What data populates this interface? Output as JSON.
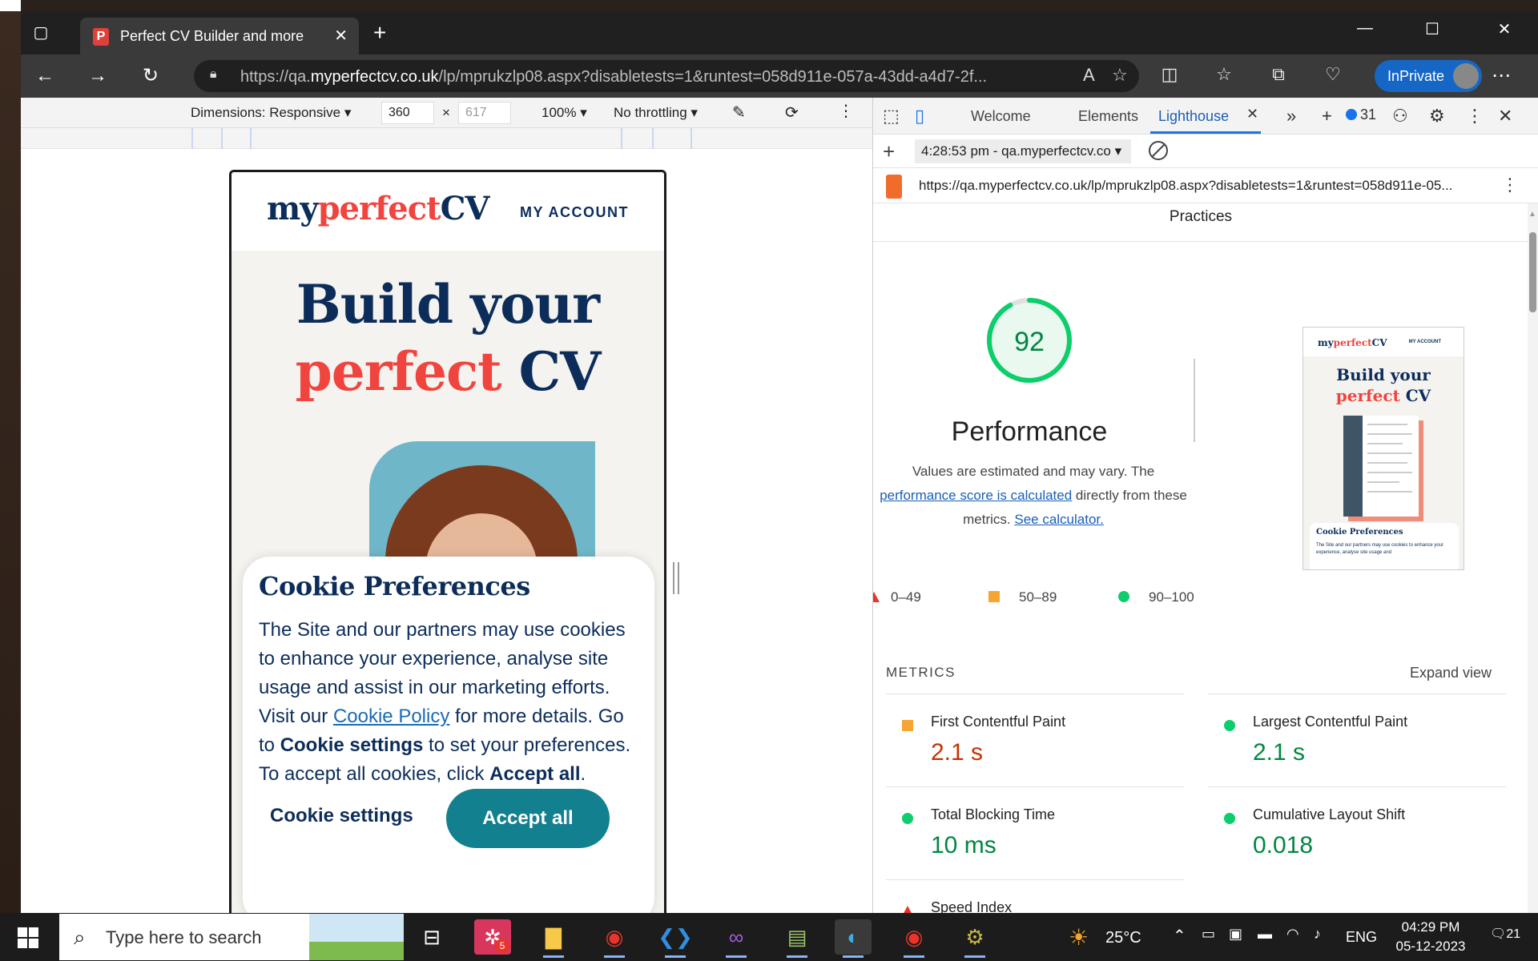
{
  "browser": {
    "tab_title": "Perfect CV Builder and more",
    "url_prefix": "https://qa.",
    "url_domain": "myperfectcv.co.uk",
    "url_rest": "/lp/mprukzlp08.aspx?disabletests=1&runtest=058d911e-057a-43dd-a4d7-2f...",
    "inprivate_label": "InPrivate"
  },
  "device_toolbar": {
    "dimensions_label": "Dimensions: Responsive",
    "width": "360",
    "height": "617",
    "zoom": "100%",
    "throttling": "No throttling"
  },
  "site": {
    "logo_part1": "my",
    "logo_part2": "perfect",
    "logo_part3": "CV",
    "account_link": "MY ACCOUNT",
    "hero_line1": "Build your",
    "hero_line2_red": "perfect",
    "hero_line2_rest": " CV",
    "cookie": {
      "title": "Cookie Preferences",
      "text_1": "The Site and our partners may use cookies to enhance your experience, analyse site usage and assist in our marketing efforts. Visit our ",
      "policy_link": "Cookie Policy",
      "text_2": " for more details. Go to ",
      "settings_bold": "Cookie settings",
      "text_3": " to set your preferences. To accept all cookies, click ",
      "accept_bold": "Accept all",
      "text_4": ".",
      "settings_button": "Cookie settings",
      "accept_button": "Accept all"
    }
  },
  "devtools": {
    "tabs": [
      "Welcome",
      "Elements",
      "Lighthouse"
    ],
    "issue_count": "31",
    "report_selector": "4:28:53 pm - qa.myperfectcv.co",
    "report_url": "https://qa.myperfectcv.co.uk/lp/mprukzlp08.aspx?disabletests=1&runtest=058d911e-05...",
    "section_title": "Practices",
    "score": "92",
    "score_fraction": 0.92,
    "category": "Performance",
    "note_1": "Values are estimated and may vary. The",
    "note_link1": "performance score is calculated",
    "note_2": " directly from these metrics. ",
    "note_link2": "See calculator.",
    "legend": {
      "fail": "0–49",
      "average": "50–89",
      "pass": "90–100"
    },
    "thumb": {
      "logo1": "my",
      "logo2": "perfect",
      "logo3": "CV",
      "account": "MY ACCOUNT",
      "hero1": "Build your",
      "hero2_red": "perfect",
      "hero2_rest": " CV",
      "cookie_title": "Cookie Preferences",
      "cookie_text": "The Site and our partners may use cookies to enhance your experience, analyse site usage and"
    },
    "metrics_heading": "METRICS",
    "expand_view": "Expand view",
    "metrics": [
      {
        "label": "First Contentful Paint",
        "value": "2.1 s",
        "status": "average",
        "color": "#c33300"
      },
      {
        "label": "Largest Contentful Paint",
        "value": "2.1 s",
        "status": "pass",
        "color": "#018642"
      },
      {
        "label": "Total Blocking Time",
        "value": "10 ms",
        "status": "pass",
        "color": "#018642"
      },
      {
        "label": "Cumulative Layout Shift",
        "value": "0.018",
        "status": "pass",
        "color": "#018642"
      },
      {
        "label": "Speed Index",
        "value": "",
        "status": "fail",
        "color": "#e8342a"
      }
    ],
    "colors": {
      "pass": "#0cce6b",
      "average": "#f7a531",
      "fail": "#e8342a"
    }
  },
  "taskbar": {
    "search_placeholder": "Type here to search",
    "slack_badge": "5",
    "temperature": "25°C",
    "language": "ENG",
    "time": "04:29 PM",
    "date": "05-12-2023",
    "notifications": "21"
  }
}
